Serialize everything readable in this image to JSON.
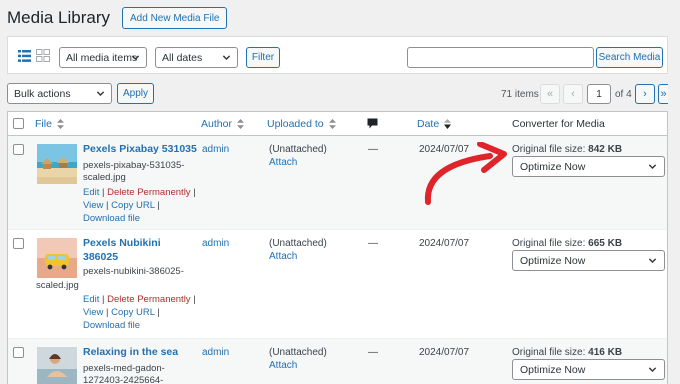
{
  "header": {
    "title": "Media Library",
    "add_new_label": "Add New Media File"
  },
  "filters": {
    "media_type": "All media items",
    "dates": "All dates",
    "filter_label": "Filter",
    "search_label": "Search Media",
    "search_value": ""
  },
  "tablenav": {
    "bulk_actions": "Bulk actions",
    "apply_label": "Apply",
    "items_count": "71 items",
    "first": "«",
    "prev": "‹",
    "current_page": "1",
    "of_pages": "of 4",
    "next": "›",
    "last": "»"
  },
  "columns": {
    "file": "File",
    "author": "Author",
    "uploaded_to": "Uploaded to",
    "date": "Date",
    "converter": "Converter for Media"
  },
  "actions": {
    "edit": "Edit",
    "delete": "Delete Permanently",
    "view": "View",
    "copy": "Copy URL",
    "download": "Download file",
    "sep": " | "
  },
  "rows": [
    {
      "title": "Pexels Pixabay 531035",
      "filename_1": "pexels-pixabay-531035-",
      "filename_2": "scaled.jpg",
      "author": "admin",
      "uploaded": "(Unattached)",
      "attach": "Attach",
      "comments": "—",
      "date": "2024/07/07",
      "size_label": "Original file size:",
      "size_value": "842 KB",
      "optimize": "Optimize Now"
    },
    {
      "title_1": "Pexels Nubikini",
      "title_2": "386025",
      "filename_1": "pexels-nubikini-386025-",
      "filename_2": "scaled.jpg",
      "author": "admin",
      "uploaded": "(Unattached)",
      "attach": "Attach",
      "comments": "—",
      "date": "2024/07/07",
      "size_label": "Original file size:",
      "size_value": "665 KB",
      "optimize": "Optimize Now"
    },
    {
      "title": "Relaxing in the sea",
      "filename_1": "pexels-med-gadon-",
      "filename_2": "1272403-2425664-",
      "author": "admin",
      "uploaded": "(Unattached)",
      "attach": "Attach",
      "comments": "—",
      "date": "2024/07/07",
      "size_label": "Original file size:",
      "size_value": "416 KB",
      "optimize": "Optimize Now"
    }
  ],
  "colors": {
    "accent": "#2271b1",
    "delete": "#b32d2e",
    "arrow": "#e0242b"
  },
  "icons": [
    "list-view-icon",
    "grid-view-icon",
    "comment-bubble-icon",
    "sort-arrows-icon",
    "chevron-down-icon"
  ]
}
